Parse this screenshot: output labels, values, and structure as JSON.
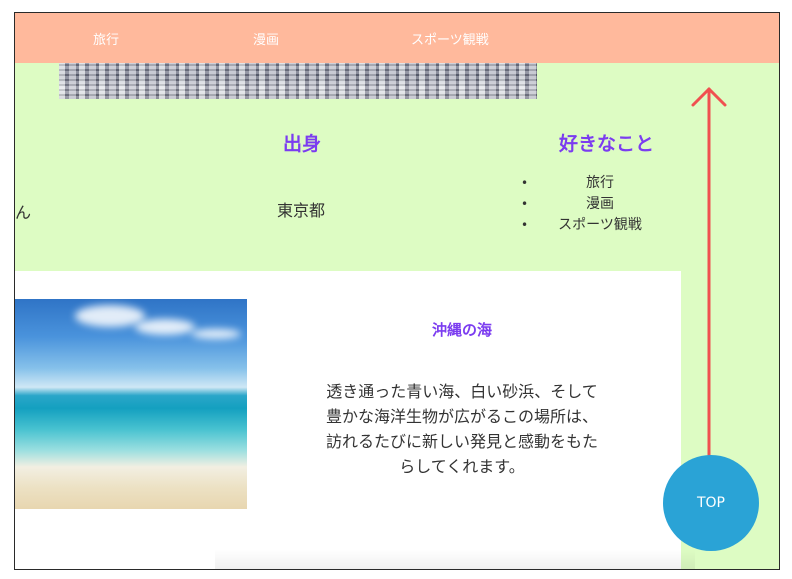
{
  "nav": {
    "items": [
      "旅行",
      "漫画",
      "スポーツ観戦"
    ]
  },
  "profile": {
    "name_fragment": "ん",
    "birthplace_heading": "出身",
    "birthplace_value": "東京都",
    "likes_heading": "好きなこと",
    "likes": [
      "旅行",
      "漫画",
      "スポーツ観戦"
    ]
  },
  "card": {
    "title": "沖縄の海",
    "description_lines": [
      "透き通った青い海、白い砂浜、そして",
      "豊かな海洋生物が広がるこの場所は、",
      "訪れるたびに新しい発見と感動をもた",
      "らしてくれます。"
    ]
  },
  "top_button": {
    "label": "TOP"
  },
  "colors": {
    "nav_bg": "#ffb99c",
    "page_bg": "#ddfcc3",
    "heading": "#7b3cf0",
    "top_button": "#2aa3d6",
    "arrow": "#f05050"
  }
}
